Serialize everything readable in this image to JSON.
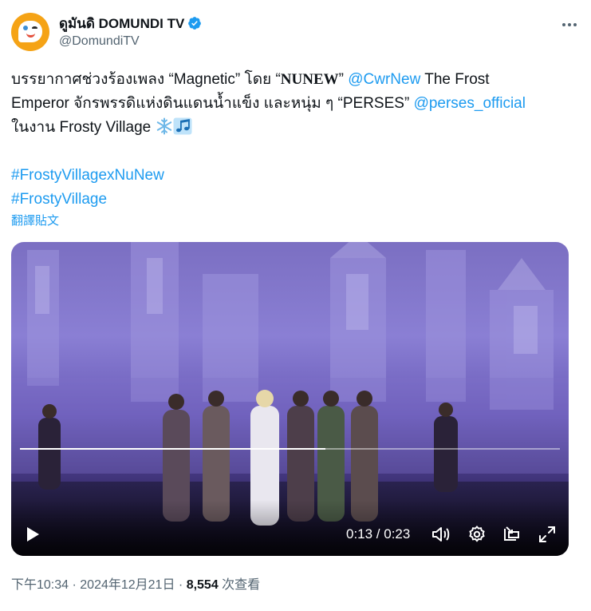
{
  "author": {
    "display_name": "ดูมันดิ DOMUNDI TV",
    "handle": "@DomundiTV",
    "verified": true,
    "avatar_color": "#f5a316"
  },
  "tweet": {
    "line1_a": "บรรยากาศช่วงร้องเพลง “Magnetic” โดย “",
    "line1_b": "NUNEW",
    "line1_c": "” ",
    "line1_mention": "@CwrNew",
    "line1_d": " The Frost",
    "line2_a": "Emperor จักรพรรดิแห่งดินแดนน้ำแข็ง และหนุ่ม ๆ “PERSES” ",
    "line2_mention": "@perses_official",
    "line3_a": "ในงาน Frosty Village ",
    "line3_emojis": [
      "snowflake-icon",
      "music-notes-icon"
    ],
    "hashtags": [
      "#FrostyVillagexNuNew",
      "#FrostyVillage"
    ],
    "translate_label": "翻譯貼文",
    "link_color": "#1d9bf0"
  },
  "video": {
    "progress": 0.565,
    "time_label": "0:13 / 0:23",
    "controls": [
      "play-icon",
      "volume-icon",
      "settings-icon",
      "popout-icon",
      "fullscreen-icon"
    ]
  },
  "footer": {
    "time": "下午10:34",
    "sep1": " · ",
    "date": "2024年12月21日",
    "sep2": " · ",
    "views_count": "8,554",
    "views_label": " 次查看"
  },
  "more_icon": "more-horizontal-icon"
}
